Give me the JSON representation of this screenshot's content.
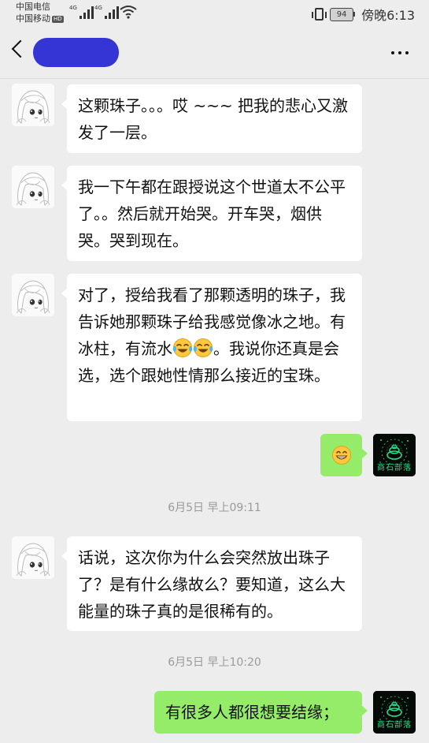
{
  "status_bar": {
    "carrier_1": "中国电信",
    "carrier_2": "中国移动",
    "hd_badge": "HD",
    "network_1": "4G",
    "network_2": "4G",
    "battery": "94",
    "time": "傍晚6:13"
  },
  "header": {
    "contact_name": "(redacted)"
  },
  "messages": [
    {
      "side": "left",
      "text": "这颗珠子。。。哎 ~~~ 把我的悲心又激发了一层。"
    },
    {
      "side": "left",
      "text": "我一下午都在跟授说这个世道太不公平了。。然后就开始哭。开车哭，烟供哭。哭到现在。"
    },
    {
      "side": "left",
      "text_before_emoji": "对了，授给我看了那颗透明的珠子，我告诉她那颗珠子给我感觉像冰之地。有冰柱，有流水",
      "emoji": "tears-of-joy",
      "text_after_emoji": "。我说你还真是会选，选个跟她性情那么接近的宝珠。"
    },
    {
      "side": "right",
      "emoji": "grinning-face"
    },
    {
      "side": "left",
      "text": "话说，这次你为什么会突然放出珠子了？是有什么缘故么？要知道，这么大能量的珠子真的是很稀有的。"
    },
    {
      "side": "right",
      "text": "有很多人都很想要结缘；"
    }
  ],
  "timestamps": [
    "6月5日 早上09:11",
    "6月5日 早上10:20"
  ],
  "avatar_right_text": "商石部落",
  "colors": {
    "background": "#ededed",
    "own_bubble": "#95ec69",
    "other_bubble": "#ffffff",
    "brand_green": "#2fd68a"
  }
}
